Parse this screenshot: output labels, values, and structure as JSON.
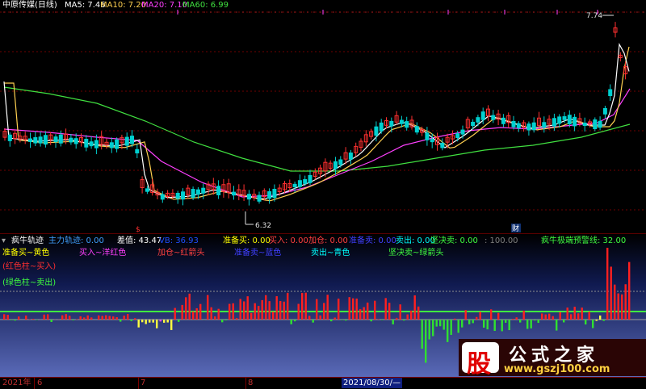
{
  "header": {
    "stock_name": "中原传媒(日线)",
    "ma5": {
      "label": "MA5: 7.46",
      "color": "#ffffff"
    },
    "ma10": {
      "label": "MA10: 7.20",
      "color": "#ffd050"
    },
    "ma20": {
      "label": "MA20: 7.10",
      "color": "#ff40ff"
    },
    "ma60": {
      "label": "MA60: 6.99",
      "color": "#40e040"
    }
  },
  "main_chart": {
    "high_label": "7.74",
    "low_label": "6.32",
    "marker_s": "$",
    "marker_cai": "财",
    "colors": {
      "up": "#ff3030",
      "down": "#00d0d0",
      "grid": "#700000"
    }
  },
  "indicator": {
    "name": "疯牛轨迹",
    "fields": [
      {
        "label": "主力轨迹: 0.00",
        "color": "#40a0ff"
      },
      {
        "label": "差值: 43.47",
        "color": "#ffffff"
      },
      {
        "label": "VB: 36.93",
        "color": "#2050ff"
      },
      {
        "label": "准备买: 0.00",
        "color": "#ffff00"
      },
      {
        "label": "买入: 0.00",
        "color": "#ff4040"
      },
      {
        "label": "加仓: 0.00",
        "color": "#ff4040"
      },
      {
        "label": "准备卖: 0.00",
        "color": "#4040ff"
      },
      {
        "label": "卖出: 0.00",
        "color": "#00ffff"
      },
      {
        "label": "坚决卖: 0.00",
        "color": "#40ff40"
      },
      {
        "label": ": 100.00",
        "color": "#808080"
      },
      {
        "label": "疯牛极端预警线: 32.00",
        "color": "#40ff40"
      }
    ],
    "legend": [
      {
        "label": "准备买~黄色",
        "color": "#ffff00"
      },
      {
        "label": "买入~洋红色",
        "color": "#ff40ff"
      },
      {
        "label": "加仓~红箭头",
        "color": "#ff4040"
      },
      {
        "label": "准备卖~蓝色",
        "color": "#4040ff"
      },
      {
        "label": "卖出~青色",
        "color": "#00ffff"
      },
      {
        "label": "坚决卖~绿箭头",
        "color": "#40ff40"
      }
    ],
    "note_red": "(红色柱~买入)",
    "note_green": "(绿色柱~卖出)"
  },
  "time_axis": {
    "year": "2021年",
    "m6": "6",
    "m7": "7",
    "m8": "8",
    "current_date": "2021/08/30/—"
  },
  "logo": {
    "glyph": "股",
    "text": "公式之家",
    "url": "www.gszj100.com"
  }
}
